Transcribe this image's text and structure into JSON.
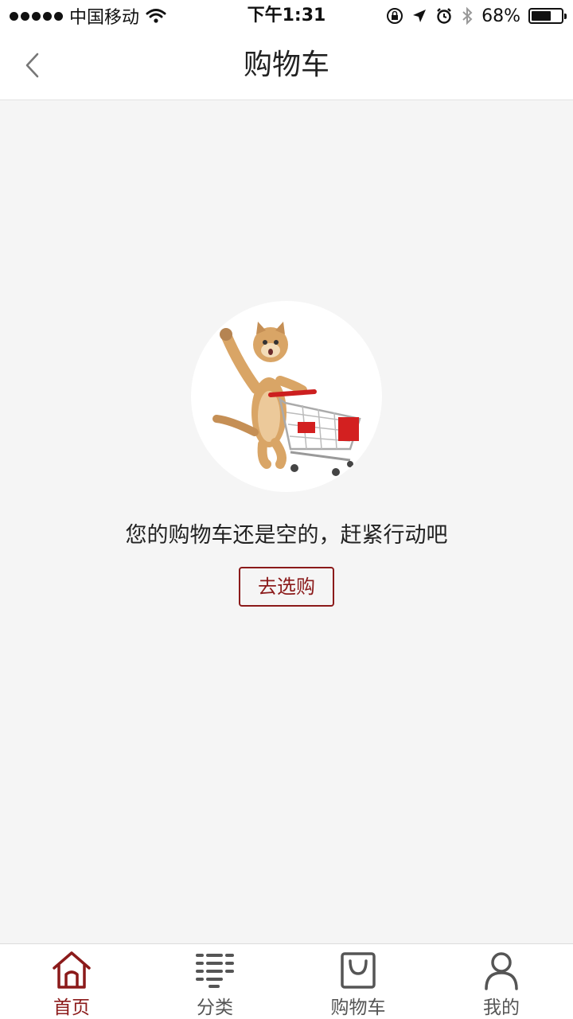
{
  "status_bar": {
    "carrier": "中国移动",
    "time": "下午1:31",
    "battery": "68%",
    "battery_level": 0.68
  },
  "header": {
    "title": "购物车",
    "back_icon": "chevron-left-icon"
  },
  "empty_cart": {
    "message": "您的购物车还是空的，赶紧行动吧",
    "button_label": "去选购",
    "illustration": "cat-with-shopping-cart"
  },
  "tabs": [
    {
      "label": "首页",
      "icon": "home-icon",
      "active": true
    },
    {
      "label": "分类",
      "icon": "category-list-icon",
      "active": false
    },
    {
      "label": "购物车",
      "icon": "shopping-bag-icon",
      "active": false
    },
    {
      "label": "我的",
      "icon": "user-icon",
      "active": false
    }
  ],
  "colors": {
    "accent": "#8b1a1a",
    "background": "#f5f5f5",
    "tab_inactive": "#555555"
  }
}
